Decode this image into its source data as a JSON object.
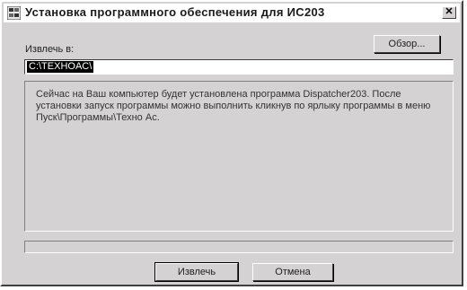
{
  "window": {
    "title": "Установка программного обеспечения для ИС203",
    "close_glyph": "✕"
  },
  "form": {
    "extract_to_label": "Извлечь в:",
    "path_value": "C:\\TEXHOAC\\",
    "browse_label": "Обзор..."
  },
  "message": {
    "text": "Сейчас на Ваш компьютер будет установлена программа  Dispatcher203. После установки запуск программы можно выполнить кликнув по ярлыку программы в меню Пуск\\Программы\\Техно Ас."
  },
  "progress": {
    "value": 0
  },
  "buttons": {
    "extract_label": "Извлечь",
    "cancel_label": "Отмена"
  },
  "icons": {
    "app_icon": "installer-app-icon",
    "close_icon": "close-icon"
  }
}
